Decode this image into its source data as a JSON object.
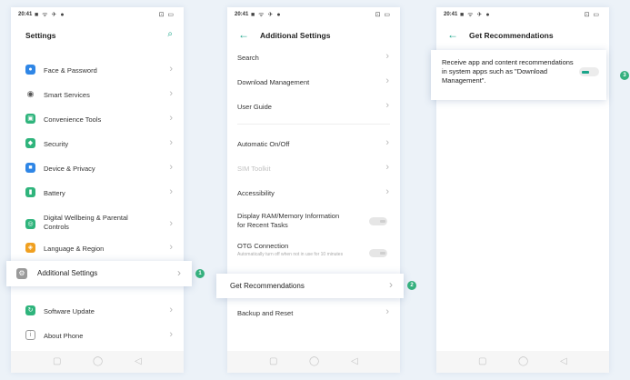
{
  "status": {
    "time": "20:41",
    "left_icons": "■ ᯤ ✈ ●",
    "right_icons": "⊡ ▭"
  },
  "phone1": {
    "title": "Settings",
    "items": [
      {
        "label": "Face & Password",
        "icon": "face-password-icon",
        "color": "#2f86e6",
        "glyph": "👤"
      },
      {
        "label": "Smart Services",
        "icon": "smart-services-icon",
        "color": "#666666",
        "glyph": "◉"
      },
      {
        "label": "Convenience Tools",
        "icon": "convenience-tools-icon",
        "color": "#2fb47c",
        "glyph": "▣"
      },
      {
        "label": "Security",
        "icon": "security-icon",
        "color": "#2fb47c",
        "glyph": "◆"
      },
      {
        "label": "Device & Privacy",
        "icon": "device-privacy-icon",
        "color": "#2f86e6",
        "glyph": "■"
      },
      {
        "label": "Battery",
        "icon": "battery-icon",
        "color": "#2fb47c",
        "glyph": "▮"
      },
      {
        "label": "Digital Wellbeing & Parental Controls",
        "icon": "digital-wellbeing-icon",
        "color": "#2fb47c",
        "glyph": "◎"
      },
      {
        "label": "Language & Region",
        "icon": "language-region-icon",
        "color": "#f0a020",
        "glyph": "◈"
      },
      {
        "label": "Software Update",
        "icon": "software-update-icon",
        "color": "#2fb47c",
        "glyph": "↻"
      },
      {
        "label": "About Phone",
        "icon": "about-phone-icon",
        "color": "#888888",
        "glyph": "ℹ"
      }
    ],
    "highlight": {
      "label": "Additional Settings",
      "icon": "additional-settings-icon",
      "badge": "1"
    }
  },
  "phone2": {
    "title": "Additional Settings",
    "items": [
      {
        "label": "Search"
      },
      {
        "label": "Download Management"
      },
      {
        "label": "User Guide"
      },
      {
        "label": "Automatic On/Off"
      },
      {
        "label": "SIM Toolkit"
      },
      {
        "label": "Accessibility"
      },
      {
        "label": "Display RAM/Memory Information for Recent Tasks"
      },
      {
        "label": "OTG Connection",
        "sub": "Automatically turn off when not in use for 10 minutes"
      },
      {
        "label": "Backup and Reset"
      }
    ],
    "highlight": {
      "label": "Get Recommendations",
      "badge": "2"
    }
  },
  "phone3": {
    "title": "Get Recommendations",
    "popup_text": "Receive app and content recommendations in system apps such as \"Download Management\".",
    "badge": "3"
  },
  "navbar": {
    "left": "▢",
    "center": "◯",
    "right": "◁"
  }
}
